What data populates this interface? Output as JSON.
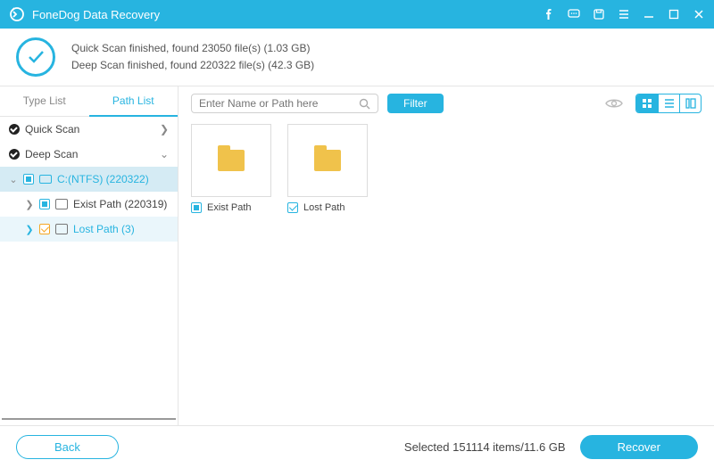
{
  "app": {
    "title": "FoneDog Data Recovery"
  },
  "status": {
    "line1": "Quick Scan finished, found 23050 file(s) (1.03 GB)",
    "line2": "Deep Scan finished, found 220322 file(s) (42.3 GB)"
  },
  "sidebar": {
    "tabs": {
      "type_list": "Type List",
      "path_list": "Path List",
      "active": "path_list"
    },
    "nodes": {
      "quick_scan": "Quick Scan",
      "deep_scan": "Deep Scan",
      "drive": "C:(NTFS) (220322)",
      "exist_path": "Exist Path (220319)",
      "lost_path": "Lost Path (3)"
    }
  },
  "toolbar": {
    "search_placeholder": "Enter Name or Path here",
    "filter_label": "Filter"
  },
  "grid": {
    "items": [
      {
        "label": "Exist Path",
        "state": "partial"
      },
      {
        "label": "Lost Path",
        "state": "checked"
      }
    ]
  },
  "footer": {
    "back_label": "Back",
    "selection": "Selected 151114 items/11.6 GB",
    "recover_label": "Recover"
  }
}
